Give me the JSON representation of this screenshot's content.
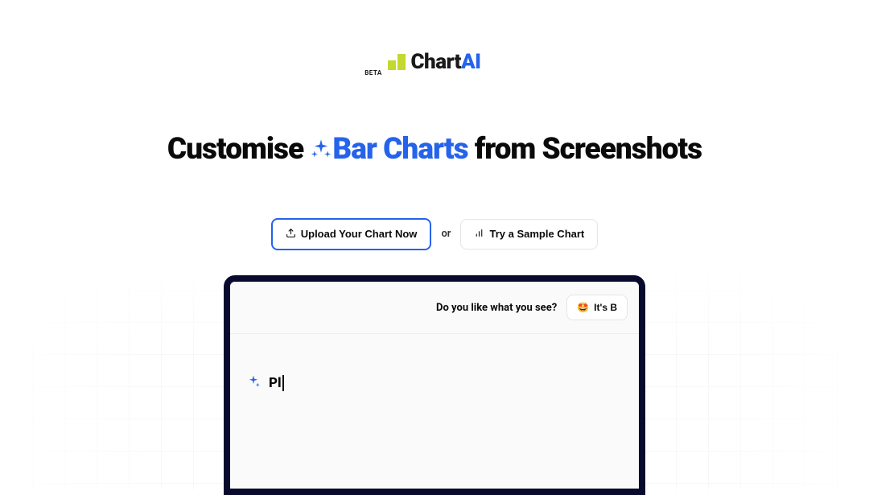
{
  "logo": {
    "beta_label": "BETA",
    "text_chart": "Chart",
    "text_ai": "AI"
  },
  "headline": {
    "prefix": "Customise ",
    "highlight": "Bar Charts",
    "suffix": " from Screenshots"
  },
  "cta": {
    "primary_label": "Upload Your Chart Now",
    "or_label": "or",
    "secondary_label": "Try a Sample Chart"
  },
  "demo": {
    "header_question": "Do you like what you see?",
    "header_button_label": "It's B",
    "typing_text": "Pl"
  }
}
